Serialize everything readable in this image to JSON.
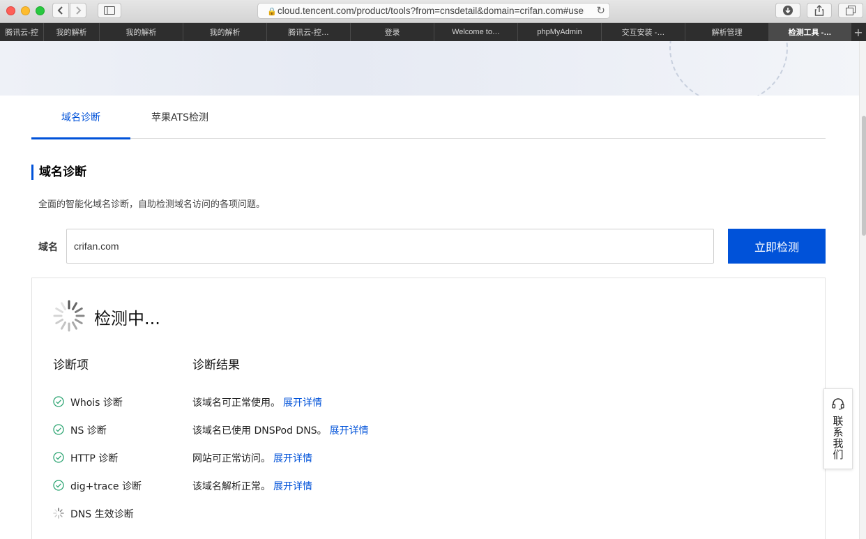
{
  "browser": {
    "address": "cloud.tencent.com/product/tools?from=cnsdetail&domain=crifan.com#user",
    "tabs": [
      {
        "label": "腾讯云-控"
      },
      {
        "label": "我的解析"
      },
      {
        "label": "我的解析"
      },
      {
        "label": "我的解析"
      },
      {
        "label": "腾讯云-控…"
      },
      {
        "label": "登录"
      },
      {
        "label": "Welcome to…"
      },
      {
        "label": "phpMyAdmin"
      },
      {
        "label": "交互安装 -…"
      },
      {
        "label": "解析管理"
      },
      {
        "label": "检测工具 -…"
      }
    ],
    "new_tab": "+"
  },
  "page": {
    "tabs": [
      {
        "label": "域名诊断"
      },
      {
        "label": "苹果ATS检测"
      }
    ],
    "section_title": "域名诊断",
    "section_desc": "全面的智能化域名诊断，自助检测域名访问的各项问题。",
    "domain_label": "域名",
    "domain_value": "crifan.com",
    "check_button": "立即检测",
    "checking_title": "检测中...",
    "col_item": "诊断项",
    "col_result": "诊断结果",
    "rows": [
      {
        "name": "Whois 诊断",
        "result": "该域名可正常使用。",
        "link": "展开详情",
        "status": "ok"
      },
      {
        "name": "NS 诊断",
        "result": "该域名已使用 DNSPod DNS。",
        "link": "展开详情",
        "status": "ok"
      },
      {
        "name": "HTTP 诊断",
        "result": "网站可正常访问。",
        "link": "展开详情",
        "status": "ok"
      },
      {
        "name": "dig+trace 诊断",
        "result": "该域名解析正常。",
        "link": "展开详情",
        "status": "ok"
      },
      {
        "name": "DNS 生效诊断",
        "result": "",
        "link": "",
        "status": "loading"
      }
    ],
    "contact_label": "联系我们"
  },
  "colors": {
    "accent": "#0052d9",
    "ok": "#2ba471"
  }
}
